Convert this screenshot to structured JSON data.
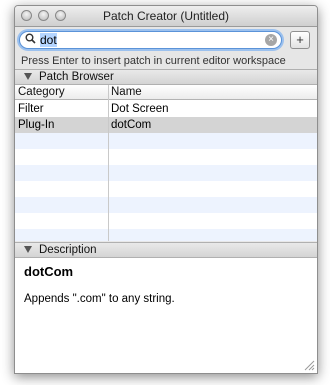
{
  "window": {
    "title": "Patch Creator (Untitled)"
  },
  "search": {
    "value": "dot",
    "add_label": "+",
    "clear_glyph": "×",
    "search_glyph": "🔍"
  },
  "hint": "Press Enter to insert patch in current editor workspace",
  "patch_browser": {
    "label": "Patch Browser",
    "columns": [
      "Category",
      "Name"
    ],
    "rows": [
      {
        "category": "Filter",
        "name": "Dot Screen"
      },
      {
        "category": "Plug-In",
        "name": "dotCom"
      }
    ],
    "selected_row": 1
  },
  "description": {
    "label": "Description",
    "title": "dotCom",
    "text": "Appends \".com\" to any string."
  },
  "colors": {
    "selection": "#d4d4d4",
    "alt_row": "#edf3fe",
    "focus_ring": "#5b93d8"
  }
}
